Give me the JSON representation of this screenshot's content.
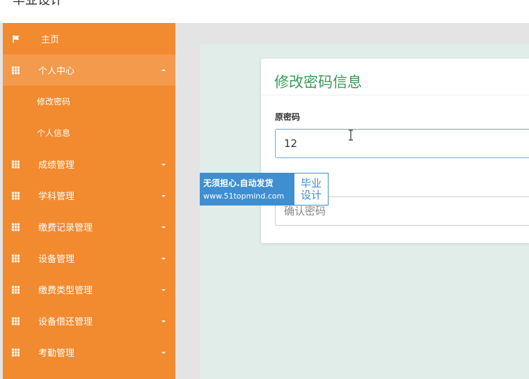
{
  "header": {
    "title": "毕业设计"
  },
  "sidebar": {
    "items": [
      {
        "label": "主页",
        "icon": "flag-icon"
      },
      {
        "label": "个人中心",
        "icon": "grid-icon",
        "expanded": true,
        "children": [
          {
            "label": "修改密码"
          },
          {
            "label": "个人信息"
          }
        ]
      },
      {
        "label": "成绩管理",
        "icon": "grid-icon"
      },
      {
        "label": "学科管理",
        "icon": "grid-icon"
      },
      {
        "label": "缴费记录管理",
        "icon": "grid-icon"
      },
      {
        "label": "设备管理",
        "icon": "grid-icon"
      },
      {
        "label": "缴费类型管理",
        "icon": "grid-icon"
      },
      {
        "label": "设备借还管理",
        "icon": "grid-icon"
      },
      {
        "label": "考勤管理",
        "icon": "grid-icon"
      }
    ]
  },
  "form": {
    "title": "修改密码信息",
    "old_password": {
      "label": "原密码",
      "value": "12"
    },
    "confirm_password": {
      "placeholder": "确认密码",
      "value": ""
    }
  },
  "watermark": {
    "line1": "无须担心.自动发货",
    "line2": "www.51topmind.com",
    "badge_line1": "毕业",
    "badge_line2": "设计"
  },
  "colors": {
    "sidebar_bg": "#f28a2f",
    "sidebar_active": "#f39a4c",
    "accent_green": "#3a9a5a",
    "content_bg": "#e1ede8",
    "watermark_blue": "#3e8fd1"
  }
}
